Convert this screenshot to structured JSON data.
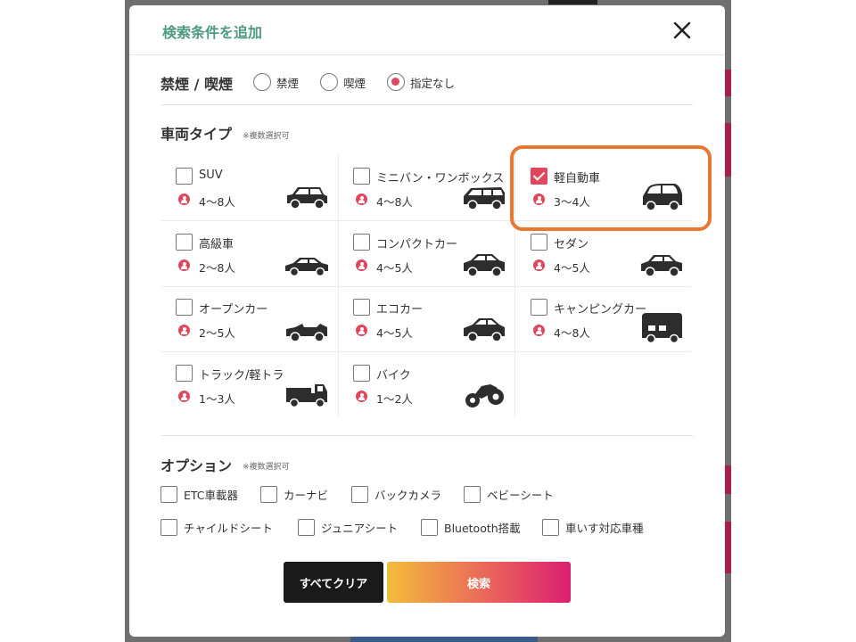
{
  "modal": {
    "title": "検索条件を追加",
    "close_icon": "close-icon"
  },
  "smoking": {
    "label": "禁煙 / 喫煙",
    "options": [
      {
        "label": "禁煙",
        "selected": false
      },
      {
        "label": "喫煙",
        "selected": false
      },
      {
        "label": "指定なし",
        "selected": true
      }
    ]
  },
  "vehicle_type": {
    "label": "車両タイプ",
    "note": "※複数選択可",
    "items": [
      {
        "name": "SUV",
        "capacity": "4〜8人",
        "checked": false,
        "icon": "suv-icon"
      },
      {
        "name": "ミニバン・ワンボックス",
        "capacity": "4〜8人",
        "checked": false,
        "icon": "minivan-icon"
      },
      {
        "name": "軽自動車",
        "capacity": "3〜4人",
        "checked": true,
        "icon": "kei-car-icon"
      },
      {
        "name": "高級車",
        "capacity": "2〜8人",
        "checked": false,
        "icon": "luxury-car-icon"
      },
      {
        "name": "コンパクトカー",
        "capacity": "4〜5人",
        "checked": false,
        "icon": "compact-car-icon"
      },
      {
        "name": "セダン",
        "capacity": "4〜5人",
        "checked": false,
        "icon": "sedan-icon"
      },
      {
        "name": "オープンカー",
        "capacity": "2〜5人",
        "checked": false,
        "icon": "convertible-icon"
      },
      {
        "name": "エコカー",
        "capacity": "4〜5人",
        "checked": false,
        "icon": "eco-car-icon"
      },
      {
        "name": "キャンピングカー",
        "capacity": "4〜8人",
        "checked": false,
        "icon": "camper-icon"
      },
      {
        "name": "トラック/軽トラ",
        "capacity": "1〜3人",
        "checked": false,
        "icon": "truck-icon"
      },
      {
        "name": "バイク",
        "capacity": "1〜2人",
        "checked": false,
        "icon": "motorcycle-icon"
      }
    ]
  },
  "options": {
    "label": "オプション",
    "note": "※複数選択可",
    "items": [
      {
        "label": "ETC車載器",
        "checked": false
      },
      {
        "label": "カーナビ",
        "checked": false
      },
      {
        "label": "バックカメラ",
        "checked": false
      },
      {
        "label": "ベビーシート",
        "checked": false
      },
      {
        "label": "チャイルドシート",
        "checked": false
      },
      {
        "label": "ジュニアシート",
        "checked": false
      },
      {
        "label": "Bluetooth搭載",
        "checked": false
      },
      {
        "label": "車いす対応車種",
        "checked": false
      }
    ]
  },
  "buttons": {
    "clear": "すべてクリア",
    "search": "検索"
  },
  "colors": {
    "title_green": "#4e9a7f",
    "accent_red": "#e0475c",
    "highlight_orange": "#e87830",
    "gradient": [
      "#f3bd3a",
      "#ea6d58",
      "#dc1e70"
    ]
  }
}
